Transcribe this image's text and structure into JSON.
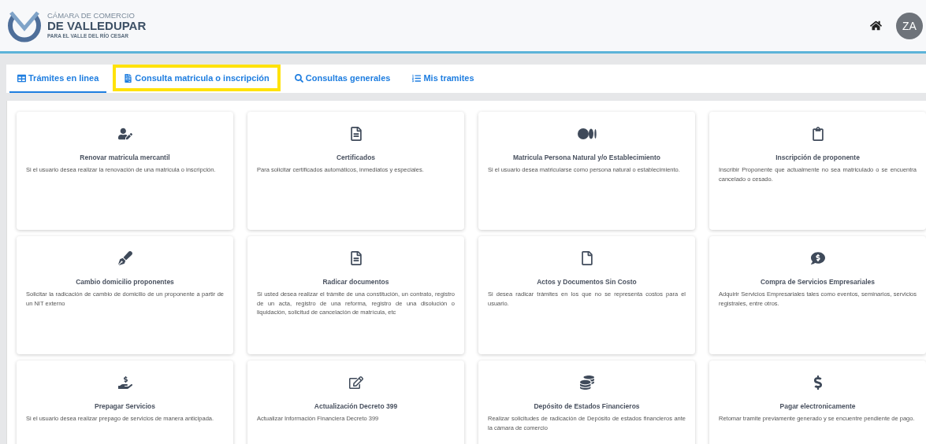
{
  "header": {
    "logo": {
      "line_1": "CÁMARA DE COMERCIO",
      "line_2": "DE VALLEDUPAR",
      "line_3": "PARA EL VALLE DEL RÍO CESAR"
    },
    "avatar": "ZA"
  },
  "tabs": [
    {
      "label": "Trámites en linea",
      "kind": "table",
      "selected": true,
      "highlighted": false
    },
    {
      "label": "Consulta matricula o inscripción",
      "kind": "file",
      "selected": false,
      "highlighted": true
    },
    {
      "label": "Consultas generales",
      "kind": "search",
      "selected": false,
      "highlighted": false
    },
    {
      "label": "Mis tramites",
      "kind": "list",
      "selected": false,
      "highlighted": false
    }
  ],
  "cards": [
    {
      "kind": "user-edit",
      "title": "Renovar matricula mercantil",
      "description": "Si el usuario desea realizar la renovación de una matricula o inscripción."
    },
    {
      "kind": "file-lines",
      "title": "Certificados",
      "description": "Para solicitar certificados automáticos, inmediatos y especiales."
    },
    {
      "kind": "dots",
      "title": "Matricula Persona Natural y/o Establecimiento",
      "description": "Si el usuario desea matricularse como persona natural o establecimiento."
    },
    {
      "kind": "clipboard",
      "title": "Inscripción de proponente",
      "description": "Inscribir Proponente que actualmente no sea matriculado o se encuentra cancelado o cesado."
    },
    {
      "kind": "pen",
      "title": "Cambio domicilio proponentes",
      "description": "Solicitar la radicación de cambio de domicilio de un proponente a partir de un NIT externo"
    },
    {
      "kind": "file-lines",
      "title": "Radicar documentos",
      "description": "Si usted desea realizar el trámite de una constitución, un contrato, registro de un acta, registro de una reforma, registro de una disolución o liquidación, solicitud de cancelación de matrícula, etc"
    },
    {
      "kind": "file",
      "title": "Actos y Documentos Sin Costo",
      "description": "Si desea radicar trámites en los que no se representa costos para el usuario."
    },
    {
      "kind": "comment-dollar",
      "title": "Compra de Servicios Empresariales",
      "description": "Adquirir Servicios Empresariales tales como eventos, seminarios, servicios registrales, entre otros."
    },
    {
      "kind": "hand-dollar",
      "title": "Prepagar Servicios",
      "description": "Si el usuario desea realizar prepago de servicios de manera anticipada."
    },
    {
      "kind": "edit",
      "title": "Actualización Decreto 399",
      "description": "Actualizar Información Financiera Decreto 399"
    },
    {
      "kind": "coins",
      "title": "Depósito de Estados Financieros",
      "description": "Realizar solicitudes de radicación de Depósito de estados financieros ante la cámara de comercio"
    },
    {
      "kind": "dollar",
      "title": "Pagar electronicamente",
      "description": "Retomar tramite previamente generado y se encuentre pendiente de pago."
    }
  ]
}
